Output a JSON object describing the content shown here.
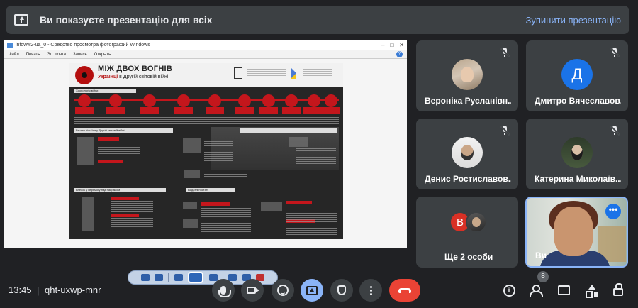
{
  "presentation_bar": {
    "title": "Ви показуєте презентацію для всіх",
    "stop_label": "Зупинити презентацію"
  },
  "shared_window": {
    "title": "infoww2-ua_0 - Средство просмотра фотографий Windows",
    "menu": [
      "Файл",
      "Печать",
      "Эл. почта",
      "Запись",
      "Открыть"
    ],
    "help": "?",
    "poster": {
      "title": "МІЖ ДВОХ ВОГНІВ",
      "subtitle_red": "Українці",
      "subtitle_rest": "в Другій світовій війні",
      "section_chrono": "Хронологія війни",
      "section_ukraine": "Втрати України у Другій світовій війні",
      "section_people": "Видатні постаті",
      "section_resist": "Внесок у перемогу над нацизмом"
    }
  },
  "participants": [
    {
      "name": "Вероніка Русланівн...",
      "avatar": "photo",
      "muted": true
    },
    {
      "name": "Дмитро Вячеславов...",
      "avatar": "Д",
      "muted": true
    },
    {
      "name": "Денис Ростиславов...",
      "avatar": "photo",
      "muted": true
    },
    {
      "name": "Катерина Миколаїв...",
      "avatar": "photo",
      "muted": true
    }
  ],
  "more_tile": {
    "label": "Ще 2 особи",
    "avatar_letter": "В"
  },
  "self_tile": {
    "name": "Ви",
    "menu_icon": "•••"
  },
  "bottom_bar": {
    "time": "13:45",
    "separator": "|",
    "meeting_code": "qht-uxwp-mnr",
    "people_count": "8"
  },
  "colors": {
    "background": "#202124",
    "tile": "#3c4043",
    "accent": "#8ab4f8",
    "end_call": "#ea4335"
  }
}
